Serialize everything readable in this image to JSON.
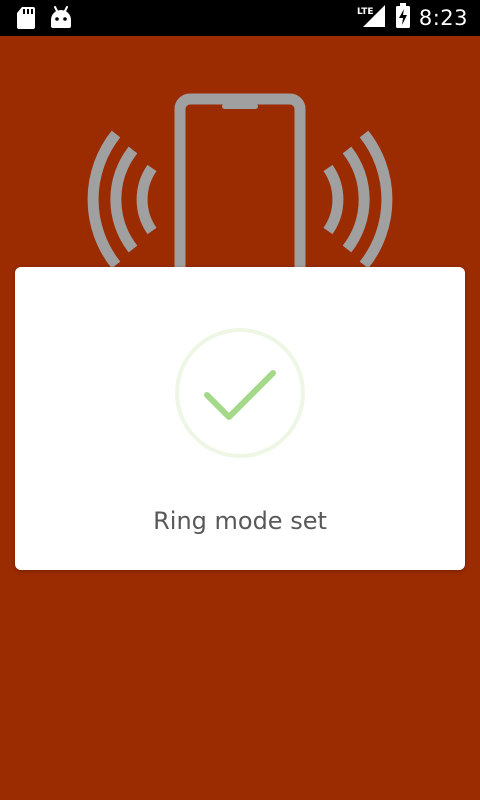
{
  "status_bar": {
    "time": "8:23",
    "network_label": "LTE",
    "icons": [
      "sd-card-icon",
      "android-debug-icon",
      "lte-signal-icon",
      "battery-charging-icon"
    ]
  },
  "dialog": {
    "message": "Ring mode set",
    "icon": "checkmark-icon"
  },
  "colors": {
    "background": "#9b2b00",
    "status_bar": "#000000",
    "dialog": "#ffffff",
    "phone_illustration": "#a0a0a0",
    "check_ring": "#eef7e6",
    "check_mark": "#a5d98a",
    "message_text": "#595959"
  }
}
